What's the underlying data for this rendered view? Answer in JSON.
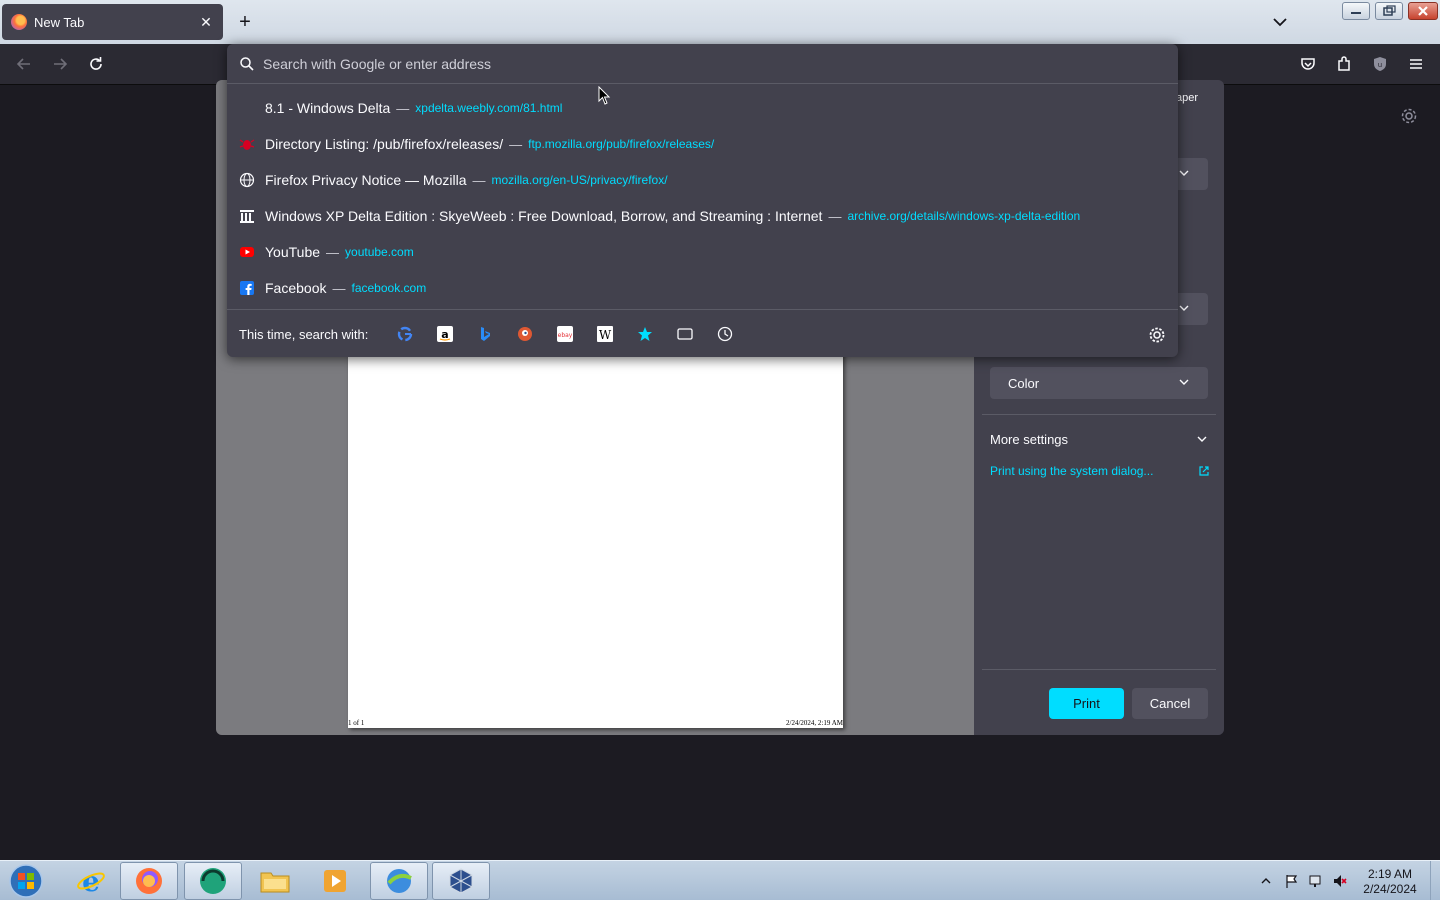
{
  "browser": {
    "tab": {
      "title": "New Tab",
      "close": "✕"
    },
    "new_tab": "+"
  },
  "urlbar": {
    "placeholder": "Search with Google or enter address",
    "results": [
      {
        "title": "8.1 - Windows Delta",
        "url": "xpdelta.weebly.com/81.html",
        "icon": "blank-icon"
      },
      {
        "title": "Directory Listing: /pub/firefox/releases/",
        "url": "ftp.mozilla.org/pub/firefox/releases/",
        "icon": "bug-icon"
      },
      {
        "title": "Firefox Privacy Notice — Mozilla",
        "url": "mozilla.org/en-US/privacy/firefox/",
        "icon": "globe-icon"
      },
      {
        "title": "Windows XP Delta Edition : SkyeWeeb : Free Download, Borrow, and Streaming : Internet",
        "url": "archive.org/details/windows-xp-delta-edition",
        "icon": "archive-icon"
      },
      {
        "title": "YouTube",
        "url": "youtube.com",
        "icon": "youtube-icon"
      },
      {
        "title": "Facebook",
        "url": "facebook.com",
        "icon": "facebook-icon"
      }
    ],
    "separator": "—",
    "oneoff_label": "This time, search with:",
    "engines": [
      "google",
      "amazon",
      "bing",
      "duckduckgo",
      "ebay",
      "wikipedia",
      "bookmarks",
      "tabs",
      "history"
    ]
  },
  "print_dialog": {
    "partial_label": "aper",
    "color_select": "Color",
    "more_settings": "More settings",
    "system_dialog_link": "Print using the system dialog...",
    "print_button": "Print",
    "cancel_button": "Cancel",
    "page_footer_left": "1 of 1",
    "page_footer_right": "2/24/2024, 2:19 AM"
  },
  "taskbar": {
    "time": "2:19 AM",
    "date": "2/24/2024"
  },
  "colors": {
    "accent": "#00ddff",
    "panel": "#42414d",
    "toolbar": "#2b2a33"
  }
}
